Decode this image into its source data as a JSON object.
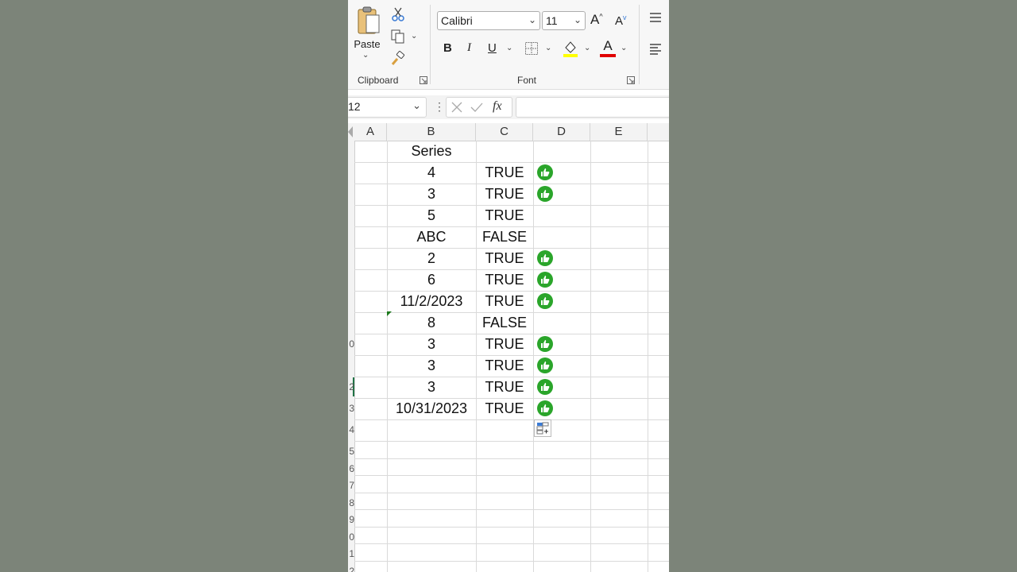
{
  "ribbon": {
    "paste_label": "Paste",
    "clipboard_label": "Clipboard",
    "font_label": "Font",
    "font_name": "Calibri",
    "font_size": "11",
    "bold": "B",
    "italic": "I",
    "underline": "U",
    "grow_font": "A",
    "shrink_font": "A",
    "font_color_letter": "A"
  },
  "formula_bar": {
    "name_box": "12",
    "fx": "fx",
    "formula": ""
  },
  "columns": [
    "A",
    "B",
    "C",
    "D",
    "E"
  ],
  "row_numbers": [
    "",
    "",
    "",
    "",
    "",
    "",
    "",
    "",
    "",
    "0",
    "",
    "2",
    "3",
    "4",
    "5",
    "6",
    "7",
    "8",
    "9",
    "0",
    "1",
    "2"
  ],
  "rows": [
    {
      "b": "Series",
      "c": "",
      "thumb": false
    },
    {
      "b": "4",
      "c": "TRUE",
      "thumb": true
    },
    {
      "b": "3",
      "c": "TRUE",
      "thumb": true
    },
    {
      "b": "5",
      "c": "TRUE",
      "thumb": false
    },
    {
      "b": "ABC",
      "c": "FALSE",
      "thumb": false
    },
    {
      "b": "2",
      "c": "TRUE",
      "thumb": true
    },
    {
      "b": "6",
      "c": "TRUE",
      "thumb": true
    },
    {
      "b": "11/2/2023",
      "c": "TRUE",
      "thumb": true
    },
    {
      "b": "8",
      "c": "FALSE",
      "thumb": false
    },
    {
      "b": "3",
      "c": "TRUE",
      "thumb": true
    },
    {
      "b": "3",
      "c": "TRUE",
      "thumb": true
    },
    {
      "b": "3",
      "c": "TRUE",
      "thumb": true
    },
    {
      "b": "10/31/2023",
      "c": "TRUE",
      "thumb": true
    }
  ],
  "colors": {
    "thumb_green": "#2aa52a",
    "highlight_yellow": "#ffff00",
    "font_red": "#e00000",
    "background": "#7c8479"
  }
}
